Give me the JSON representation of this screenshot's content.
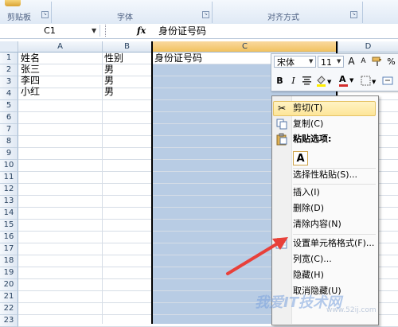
{
  "ribbon": {
    "groups": [
      "剪贴板",
      "字体",
      "对齐方式"
    ]
  },
  "formula_bar": {
    "name_box": "C1",
    "fx": "fx",
    "value": "身份证号码"
  },
  "columns": [
    "A",
    "B",
    "C",
    "D"
  ],
  "rows": [
    "1",
    "2",
    "3",
    "4",
    "5",
    "6",
    "7",
    "8",
    "9",
    "10",
    "11",
    "12",
    "13",
    "14",
    "15",
    "16",
    "17",
    "18",
    "19",
    "20",
    "21",
    "22",
    "23"
  ],
  "cells": {
    "A": [
      "姓名",
      "张三",
      "李四",
      "小红"
    ],
    "B": [
      "性别",
      "男",
      "男",
      "男"
    ],
    "C1": "身份证号码"
  },
  "mini_toolbar": {
    "font": "宋体",
    "size": "11",
    "grow": "A",
    "shrink": "A",
    "bold": "B",
    "italic": "I",
    "font_color": "A",
    "font_color_hex": "#d32d2d",
    "highlight_hex": "#ffee00"
  },
  "context_menu": {
    "items": [
      {
        "label": "剪切(T)",
        "icon": "scissors-icon"
      },
      {
        "label": "复制(C)",
        "icon": "copy-icon"
      },
      {
        "label": "粘贴选项:",
        "icon": "clipboard-icon"
      },
      {
        "label": "选择性粘贴(S)...",
        "icon": ""
      },
      {
        "label": "插入(I)",
        "icon": ""
      },
      {
        "label": "删除(D)",
        "icon": ""
      },
      {
        "label": "清除内容(N)",
        "icon": ""
      },
      {
        "label": "设置单元格格式(F)...",
        "icon": "format-cells-icon"
      },
      {
        "label": "列宽(C)...",
        "icon": ""
      },
      {
        "label": "隐藏(H)",
        "icon": ""
      },
      {
        "label": "取消隐藏(U)",
        "icon": ""
      }
    ],
    "paste_option": "A"
  },
  "watermark": {
    "text": "我爱IT技术网",
    "url": "www.52ij.com"
  },
  "colors": {
    "selection": "#b8cce4",
    "arrow": "#e8403a",
    "hover": "#fde598"
  }
}
